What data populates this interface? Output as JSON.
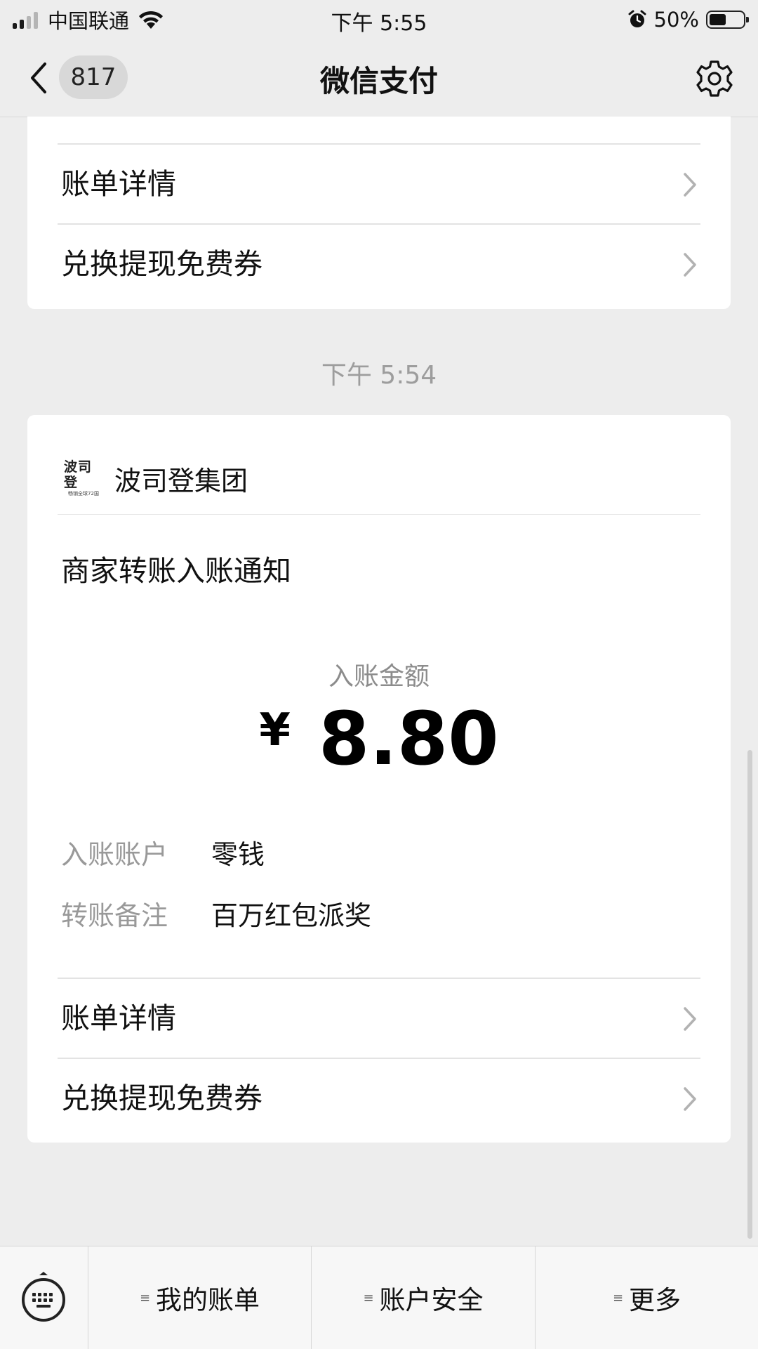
{
  "status_bar": {
    "carrier": "中国联通",
    "time": "下午 5:55",
    "battery": "50%",
    "battery_level": 0.5
  },
  "nav": {
    "back_icon": "chevron-left-icon",
    "badge_count": "817",
    "title": "微信支付",
    "settings_icon": "gear-icon"
  },
  "top_card": {
    "rows": [
      {
        "label": "账单详情"
      },
      {
        "label": "兑换提现免费券"
      }
    ]
  },
  "time_divider": "下午 5:54",
  "message": {
    "merchant": {
      "logo_text": "波司登",
      "logo_subtext": "畅销全球72国",
      "name": "波司登集团"
    },
    "title": "商家转账入账通知",
    "amount_label": "入账金额",
    "currency": "¥",
    "amount": "8.80",
    "details": [
      {
        "key": "入账账户",
        "value": "零钱"
      },
      {
        "key": "转账备注",
        "value": "百万红包派奖"
      }
    ],
    "rows": [
      {
        "label": "账单详情"
      },
      {
        "label": "兑换提现免费券"
      }
    ]
  },
  "bottom_bar": {
    "keyboard_icon": "keyboard-icon",
    "menus": [
      {
        "label": "我的账单"
      },
      {
        "label": "账户安全"
      },
      {
        "label": "更多"
      }
    ]
  },
  "colors": {
    "background": "#ededed",
    "card": "#ffffff",
    "muted_text": "#999999"
  }
}
